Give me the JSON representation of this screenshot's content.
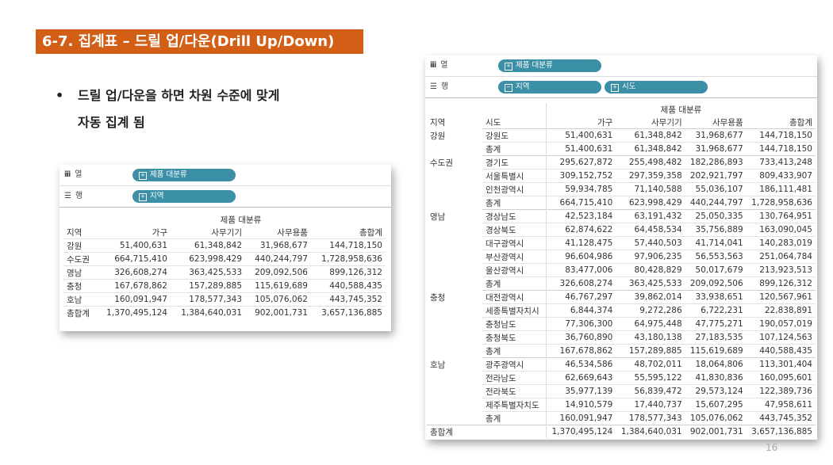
{
  "slide": {
    "title": "6-7. 집계표 – 드릴 업/다운(Drill Up/Down)",
    "bullet_dot": "•",
    "bullet_line1": "드릴 업/다운을 하면 차원 수준에 맞게",
    "bullet_line2": "자동 집계 됨",
    "page_number": "16"
  },
  "icons": {
    "columns_shelf": "columns-icon",
    "rows_shelf": "rows-icon",
    "pill_expand": "plus-box-icon",
    "pill_collapse": "minus-box-icon"
  },
  "colors": {
    "title_bg": "#d35e16",
    "pill": "#3b8fa7"
  },
  "left_view": {
    "col_shelf_label": "열",
    "row_shelf_label": "행",
    "col_pill": "제품 대분류",
    "row_pill": "지역",
    "header_group": "제품 대분류",
    "headers": [
      "지역",
      "가구",
      "사무기기",
      "사무용품",
      "총합계"
    ],
    "rows": [
      [
        "강원",
        "51,400,631",
        "61,348,842",
        "31,968,677",
        "144,718,150"
      ],
      [
        "수도권",
        "664,715,410",
        "623,998,429",
        "440,244,797",
        "1,728,958,636"
      ],
      [
        "영남",
        "326,608,274",
        "363,425,533",
        "209,092,506",
        "899,126,312"
      ],
      [
        "충청",
        "167,678,862",
        "157,289,885",
        "115,619,689",
        "440,588,435"
      ],
      [
        "호남",
        "160,091,947",
        "178,577,343",
        "105,076,062",
        "443,745,352"
      ],
      [
        "총합계",
        "1,370,495,124",
        "1,384,640,031",
        "902,001,731",
        "3,657,136,885"
      ]
    ]
  },
  "right_view": {
    "col_shelf_label": "열",
    "row_shelf_label": "행",
    "col_pill": "제품 대분류",
    "row_pill1": "지역",
    "row_pill2": "시도",
    "header_group": "제품 대분류",
    "headers": [
      "지역",
      "시도",
      "가구",
      "사무기기",
      "사무용품",
      "총합계"
    ],
    "groups": [
      {
        "region": "강원",
        "rows": [
          [
            "강원도",
            "51,400,631",
            "61,348,842",
            "31,968,677",
            "144,718,150"
          ],
          [
            "총계",
            "51,400,631",
            "61,348,842",
            "31,968,677",
            "144,718,150"
          ]
        ]
      },
      {
        "region": "수도권",
        "rows": [
          [
            "경기도",
            "295,627,872",
            "255,498,482",
            "182,286,893",
            "733,413,248"
          ],
          [
            "서울특별시",
            "309,152,752",
            "297,359,358",
            "202,921,797",
            "809,433,907"
          ],
          [
            "인천광역시",
            "59,934,785",
            "71,140,588",
            "55,036,107",
            "186,111,481"
          ],
          [
            "총계",
            "664,715,410",
            "623,998,429",
            "440,244,797",
            "1,728,958,636"
          ]
        ]
      },
      {
        "region": "영남",
        "rows": [
          [
            "경상남도",
            "42,523,184",
            "63,191,432",
            "25,050,335",
            "130,764,951"
          ],
          [
            "경상북도",
            "62,874,622",
            "64,458,534",
            "35,756,889",
            "163,090,045"
          ],
          [
            "대구광역시",
            "41,128,475",
            "57,440,503",
            "41,714,041",
            "140,283,019"
          ],
          [
            "부산광역시",
            "96,604,986",
            "97,906,235",
            "56,553,563",
            "251,064,784"
          ],
          [
            "울산광역시",
            "83,477,006",
            "80,428,829",
            "50,017,679",
            "213,923,513"
          ],
          [
            "총계",
            "326,608,274",
            "363,425,533",
            "209,092,506",
            "899,126,312"
          ]
        ]
      },
      {
        "region": "충청",
        "rows": [
          [
            "대전광역시",
            "46,767,297",
            "39,862,014",
            "33,938,651",
            "120,567,961"
          ],
          [
            "세종특별자치시",
            "6,844,374",
            "9,272,286",
            "6,722,231",
            "22,838,891"
          ],
          [
            "충청남도",
            "77,306,300",
            "64,975,448",
            "47,775,271",
            "190,057,019"
          ],
          [
            "충청북도",
            "36,760,890",
            "43,180,138",
            "27,183,535",
            "107,124,563"
          ],
          [
            "총계",
            "167,678,862",
            "157,289,885",
            "115,619,689",
            "440,588,435"
          ]
        ]
      },
      {
        "region": "호남",
        "rows": [
          [
            "광주광역시",
            "46,534,586",
            "48,702,011",
            "18,064,806",
            "113,301,404"
          ],
          [
            "전라남도",
            "62,669,643",
            "55,595,122",
            "41,830,836",
            "160,095,601"
          ],
          [
            "전라북도",
            "35,977,139",
            "56,839,472",
            "29,573,124",
            "122,389,736"
          ],
          [
            "제주특별자치도",
            "14,910,579",
            "17,440,737",
            "15,607,295",
            "47,958,611"
          ],
          [
            "총계",
            "160,091,947",
            "178,577,343",
            "105,076,062",
            "443,745,352"
          ]
        ]
      }
    ],
    "grand_total": [
      "총합계",
      "",
      "1,370,495,124",
      "1,384,640,031",
      "902,001,731",
      "3,657,136,885"
    ]
  }
}
